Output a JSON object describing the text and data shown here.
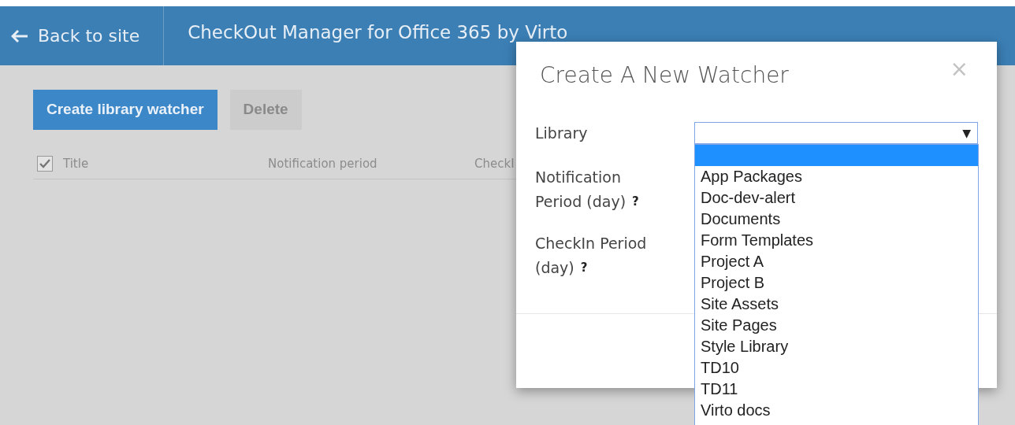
{
  "header": {
    "back_link": "Back to site",
    "title": "CheckOut Manager for Office 365 by Virto"
  },
  "toolbar": {
    "buttons": [
      {
        "label": "Create library watcher",
        "disabled": false
      },
      {
        "label": "Delete",
        "disabled": true
      }
    ]
  },
  "table": {
    "select_all_checked": true,
    "columns": [
      "Title",
      "Notification period",
      "CheckI"
    ]
  },
  "dialog": {
    "title": "Create A New Watcher",
    "close": "×",
    "fields": [
      {
        "label": "Library"
      },
      {
        "label": "Notification Period (day)",
        "help": "?"
      },
      {
        "label": "CheckIn Period (day)",
        "help": "?"
      }
    ],
    "library_dropdown": {
      "arrow": "▼",
      "options": [
        {
          "selected": true
        },
        {
          "label": "App Packages",
          "selected": false
        },
        {
          "label": "Doc-dev-alert",
          "selected": false
        },
        {
          "label": "Documents",
          "selected": false
        },
        {
          "label": "Form Templates",
          "selected": false
        },
        {
          "label": "Project A",
          "selected": false
        },
        {
          "label": "Project B",
          "selected": false
        },
        {
          "label": "Site Assets",
          "selected": false
        },
        {
          "label": "Site Pages",
          "selected": false
        },
        {
          "label": "Style Library",
          "selected": false
        },
        {
          "label": "TD10",
          "selected": false
        },
        {
          "label": "TD11",
          "selected": false
        },
        {
          "label": "Virto docs",
          "selected": false
        }
      ]
    }
  }
}
